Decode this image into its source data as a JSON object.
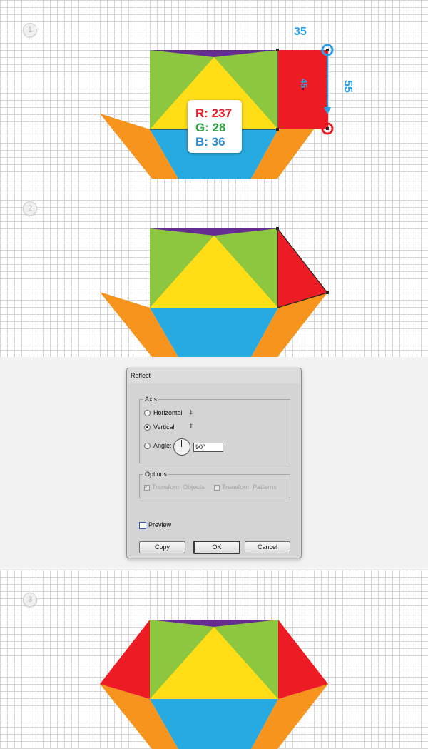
{
  "steps": [
    "1",
    "2",
    "3"
  ],
  "color_callout": {
    "r": "R: 237",
    "g": "G: 28",
    "b": "B: 36"
  },
  "measurements": {
    "width": "35",
    "inner": "45",
    "height": "55"
  },
  "colors": {
    "red": "#ed1c24",
    "green": "#8dc63f",
    "yellow": "#ffde17",
    "blue": "#27aae1",
    "orange": "#f7941d",
    "purple": "#662d91",
    "guide": "#2aa0e8"
  },
  "dialog": {
    "title": "Reflect",
    "axis_label": "Axis",
    "horizontal_label": "Horizontal",
    "vertical_label": "Vertical",
    "angle_label": "Angle:",
    "angle_value": "90°",
    "selected_axis": "Vertical",
    "options_label": "Options",
    "transform_objects_label": "Transform Objects",
    "transform_patterns_label": "Transform Patterns",
    "preview_label": "Preview",
    "copy_label": "Copy",
    "ok_label": "OK",
    "cancel_label": "Cancel"
  }
}
